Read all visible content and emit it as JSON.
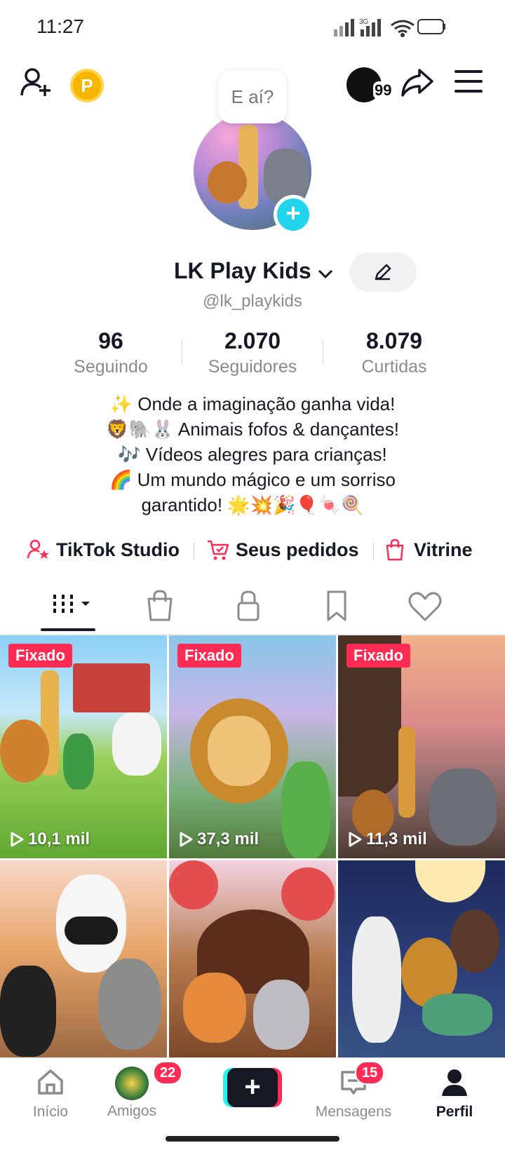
{
  "status_bar": {
    "time": "11:27",
    "network": "3G"
  },
  "top_bar": {
    "add_user_icon": "person-plus-icon",
    "points_badge": "P",
    "story_count": "99",
    "share_icon": "share-arrow-icon",
    "menu_icon": "hamburger-menu-icon"
  },
  "profile": {
    "bubble_text": "E aí?",
    "display_name": "LK Play Kids",
    "handle": "@lk_playkids",
    "stats": [
      {
        "value": "96",
        "label": "Seguindo"
      },
      {
        "value": "2.070",
        "label": "Seguidores"
      },
      {
        "value": "8.079",
        "label": "Curtidas"
      }
    ],
    "bio": [
      "✨ Onde a imaginação ganha vida!",
      "🦁🐘🐰 Animais fofos & dançantes!",
      "🎶 Vídeos alegres para crianças!",
      "🌈 Um mundo mágico e um sorriso",
      "garantido! 🌟💥🎉🎈🍬🍭"
    ]
  },
  "links": [
    {
      "label": "TikTok Studio",
      "icon": "person-star-icon"
    },
    {
      "label": "Seus pedidos",
      "icon": "cart-icon"
    },
    {
      "label": "Vitrine",
      "icon": "shopping-bag-icon"
    }
  ],
  "tabs": [
    "grid-icon",
    "shopping-bag-icon",
    "lock-icon",
    "bookmark-icon",
    "heart-icon"
  ],
  "videos": [
    {
      "pinned": "Fixado",
      "views": "10,1 mil"
    },
    {
      "pinned": "Fixado",
      "views": "37,3 mil"
    },
    {
      "pinned": "Fixado",
      "views": "11,3 mil"
    },
    {
      "pinned": "",
      "views": ""
    },
    {
      "pinned": "",
      "views": ""
    },
    {
      "pinned": "",
      "views": ""
    }
  ],
  "bottom_nav": {
    "home": "Início",
    "friends": "Amigos",
    "friends_badge": "22",
    "create": "+",
    "messages": "Mensagens",
    "messages_badge": "15",
    "profile": "Perfil"
  },
  "colors": {
    "accent": "#fe2c55",
    "cyan": "#20d5ec",
    "text": "#161823",
    "muted": "#8a8b91"
  }
}
